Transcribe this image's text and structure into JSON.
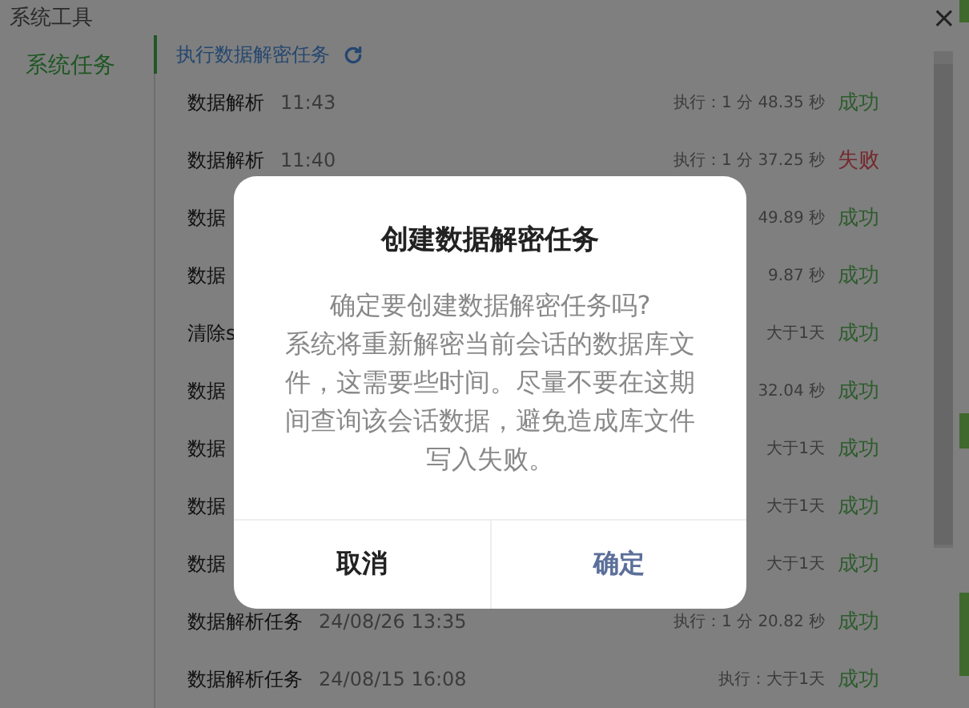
{
  "window": {
    "title": "系统工具",
    "close": "×"
  },
  "sidebar": {
    "items": [
      {
        "label": "系统任务",
        "selected": true
      }
    ]
  },
  "header": {
    "title": "执行数据解密任务"
  },
  "tasks": [
    {
      "name": "数据解析",
      "time": "11:43",
      "duration": "执行：1 分 48.35 秒",
      "status": "成功",
      "ok": true
    },
    {
      "name": "数据解析",
      "time": "11:40",
      "duration": "执行：1 分 37.25 秒",
      "status": "失败",
      "ok": false
    },
    {
      "name": "数据",
      "duration": "49.89 秒",
      "status": "成功",
      "ok": true
    },
    {
      "name": "数据",
      "duration": "9.87 秒",
      "status": "成功",
      "ok": true
    },
    {
      "name": "清除s",
      "duration": "大于1天",
      "status": "成功",
      "ok": true
    },
    {
      "name": "数据",
      "duration": "32.04 秒",
      "status": "成功",
      "ok": true
    },
    {
      "name": "数据",
      "duration": "大于1天",
      "status": "成功",
      "ok": true
    },
    {
      "name": "数据",
      "duration": "大于1天",
      "status": "成功",
      "ok": true
    },
    {
      "name": "数据",
      "duration": "大于1天",
      "status": "成功",
      "ok": true
    },
    {
      "name": "数据解析任务",
      "time": "24/08/26 13:35",
      "duration": "执行：1 分 20.82 秒",
      "status": "成功",
      "ok": true
    },
    {
      "name": "数据解析任务",
      "time": "24/08/15 16:08",
      "duration": "执行：大于1天",
      "status": "成功",
      "ok": true
    }
  ],
  "dialog": {
    "title": "创建数据解密任务",
    "message": [
      "确定要创建数据解密任务吗?",
      "系统将重新解密当前会话的数据库文",
      "件，这需要些时间。尽量不要在这期",
      "间查询该会话数据，避免造成库文件",
      "写入失败。"
    ],
    "buttons": [
      {
        "label": "取消",
        "kind": "cancel"
      },
      {
        "label": "确定",
        "kind": "confirm"
      }
    ]
  }
}
